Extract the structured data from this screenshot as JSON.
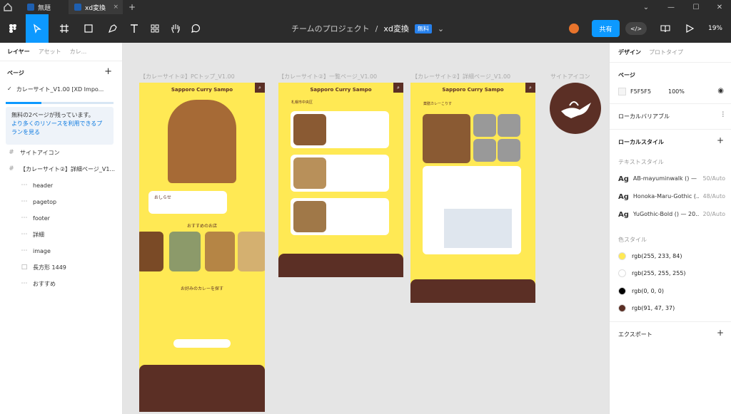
{
  "tabs": [
    {
      "label": "無題"
    },
    {
      "label": "xd変換",
      "close": "×"
    }
  ],
  "new_tab": "+",
  "toolbar": {
    "team_project": "チームのプロジェクト",
    "separator": "/",
    "file_name": "xd変換",
    "free_badge": "無料",
    "share_label": "共有",
    "zoom": "19%"
  },
  "left_panel": {
    "tabs": [
      "レイヤー",
      "アセット",
      "カレ..."
    ],
    "pages_title": "ページ",
    "page_name": "カレーサイト_V1.00 [XD Impo...",
    "promo_line1": "無料の2ページが残っています。",
    "promo_link": "より多くのリソースを利用できるプランを見る",
    "layers": [
      {
        "label": "サイトアイコン",
        "icon": "#"
      },
      {
        "label": "【カレーサイト②】詳細ページ_V1...",
        "icon": "#"
      },
      {
        "label": "header",
        "icon": "⋯"
      },
      {
        "label": "pagetop",
        "icon": "⋯"
      },
      {
        "label": "footer",
        "icon": "⋯"
      },
      {
        "label": "詳細",
        "icon": "⋯"
      },
      {
        "label": "image",
        "icon": "⋯"
      },
      {
        "label": "長方形 1449",
        "icon": "□"
      },
      {
        "label": "おすすめ",
        "icon": "⋯"
      }
    ]
  },
  "canvas": {
    "frames": [
      {
        "label": "【カレーサイト②】PCトップ_V1.00"
      },
      {
        "label": "【カレーサイト②】一覧ページ_V1.00"
      },
      {
        "label": "【カレーサイト②】詳細ページ_V1.00"
      },
      {
        "label": "サイトアイコン"
      }
    ],
    "site_title": "Sapporo Curry Sampo",
    "news_title": "おしらせ",
    "recommend_title": "おすすめのお店",
    "find_title": "お好みのカレーを探す",
    "list_area": "札幌市中央区",
    "detail_title": "薬膳カレーこりす"
  },
  "right_panel": {
    "tabs": [
      "デザイン",
      "プロトタイプ"
    ],
    "page_title": "ページ",
    "page_color": "F5F5F5",
    "page_opacity": "100%",
    "local_variables": "ローカルバリアブル",
    "local_styles": "ローカルスタイル",
    "text_styles_title": "テキストスタイル",
    "text_styles": [
      {
        "ag": "Ag",
        "name": "AB-mayuminwalk () —",
        "size": "50/Auto"
      },
      {
        "ag": "Ag",
        "name": "Honoka-Maru-Gothic (...",
        "size": "48/Auto"
      },
      {
        "ag": "Ag",
        "name": "YuGothic-Bold () — 20...",
        "size": "20/Auto"
      }
    ],
    "color_styles_title": "色スタイル",
    "colors": [
      {
        "name": "rgb(255, 233, 84)",
        "hex": "#ffe954"
      },
      {
        "name": "rgb(255, 255, 255)",
        "hex": "#ffffff"
      },
      {
        "name": "rgb(0, 0, 0)",
        "hex": "#000000"
      },
      {
        "name": "rgb(91, 47, 37)",
        "hex": "#5b2f25"
      }
    ],
    "export": "エクスポート"
  }
}
